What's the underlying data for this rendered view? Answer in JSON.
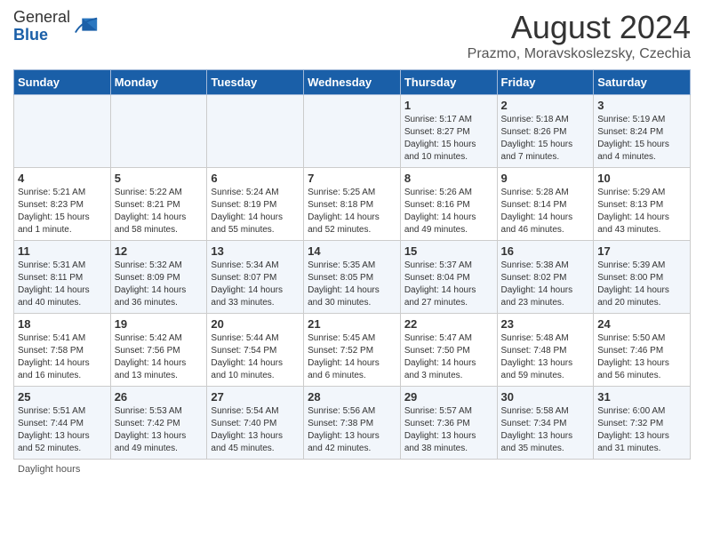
{
  "header": {
    "logo_general": "General",
    "logo_blue": "Blue",
    "main_title": "August 2024",
    "subtitle": "Prazmo, Moravskoslezsky, Czechia"
  },
  "columns": [
    "Sunday",
    "Monday",
    "Tuesday",
    "Wednesday",
    "Thursday",
    "Friday",
    "Saturday"
  ],
  "weeks": [
    {
      "days": [
        {
          "num": "",
          "info": ""
        },
        {
          "num": "",
          "info": ""
        },
        {
          "num": "",
          "info": ""
        },
        {
          "num": "",
          "info": ""
        },
        {
          "num": "1",
          "info": "Sunrise: 5:17 AM\nSunset: 8:27 PM\nDaylight: 15 hours\nand 10 minutes."
        },
        {
          "num": "2",
          "info": "Sunrise: 5:18 AM\nSunset: 8:26 PM\nDaylight: 15 hours\nand 7 minutes."
        },
        {
          "num": "3",
          "info": "Sunrise: 5:19 AM\nSunset: 8:24 PM\nDaylight: 15 hours\nand 4 minutes."
        }
      ]
    },
    {
      "days": [
        {
          "num": "4",
          "info": "Sunrise: 5:21 AM\nSunset: 8:23 PM\nDaylight: 15 hours\nand 1 minute."
        },
        {
          "num": "5",
          "info": "Sunrise: 5:22 AM\nSunset: 8:21 PM\nDaylight: 14 hours\nand 58 minutes."
        },
        {
          "num": "6",
          "info": "Sunrise: 5:24 AM\nSunset: 8:19 PM\nDaylight: 14 hours\nand 55 minutes."
        },
        {
          "num": "7",
          "info": "Sunrise: 5:25 AM\nSunset: 8:18 PM\nDaylight: 14 hours\nand 52 minutes."
        },
        {
          "num": "8",
          "info": "Sunrise: 5:26 AM\nSunset: 8:16 PM\nDaylight: 14 hours\nand 49 minutes."
        },
        {
          "num": "9",
          "info": "Sunrise: 5:28 AM\nSunset: 8:14 PM\nDaylight: 14 hours\nand 46 minutes."
        },
        {
          "num": "10",
          "info": "Sunrise: 5:29 AM\nSunset: 8:13 PM\nDaylight: 14 hours\nand 43 minutes."
        }
      ]
    },
    {
      "days": [
        {
          "num": "11",
          "info": "Sunrise: 5:31 AM\nSunset: 8:11 PM\nDaylight: 14 hours\nand 40 minutes."
        },
        {
          "num": "12",
          "info": "Sunrise: 5:32 AM\nSunset: 8:09 PM\nDaylight: 14 hours\nand 36 minutes."
        },
        {
          "num": "13",
          "info": "Sunrise: 5:34 AM\nSunset: 8:07 PM\nDaylight: 14 hours\nand 33 minutes."
        },
        {
          "num": "14",
          "info": "Sunrise: 5:35 AM\nSunset: 8:05 PM\nDaylight: 14 hours\nand 30 minutes."
        },
        {
          "num": "15",
          "info": "Sunrise: 5:37 AM\nSunset: 8:04 PM\nDaylight: 14 hours\nand 27 minutes."
        },
        {
          "num": "16",
          "info": "Sunrise: 5:38 AM\nSunset: 8:02 PM\nDaylight: 14 hours\nand 23 minutes."
        },
        {
          "num": "17",
          "info": "Sunrise: 5:39 AM\nSunset: 8:00 PM\nDaylight: 14 hours\nand 20 minutes."
        }
      ]
    },
    {
      "days": [
        {
          "num": "18",
          "info": "Sunrise: 5:41 AM\nSunset: 7:58 PM\nDaylight: 14 hours\nand 16 minutes."
        },
        {
          "num": "19",
          "info": "Sunrise: 5:42 AM\nSunset: 7:56 PM\nDaylight: 14 hours\nand 13 minutes."
        },
        {
          "num": "20",
          "info": "Sunrise: 5:44 AM\nSunset: 7:54 PM\nDaylight: 14 hours\nand 10 minutes."
        },
        {
          "num": "21",
          "info": "Sunrise: 5:45 AM\nSunset: 7:52 PM\nDaylight: 14 hours\nand 6 minutes."
        },
        {
          "num": "22",
          "info": "Sunrise: 5:47 AM\nSunset: 7:50 PM\nDaylight: 14 hours\nand 3 minutes."
        },
        {
          "num": "23",
          "info": "Sunrise: 5:48 AM\nSunset: 7:48 PM\nDaylight: 13 hours\nand 59 minutes."
        },
        {
          "num": "24",
          "info": "Sunrise: 5:50 AM\nSunset: 7:46 PM\nDaylight: 13 hours\nand 56 minutes."
        }
      ]
    },
    {
      "days": [
        {
          "num": "25",
          "info": "Sunrise: 5:51 AM\nSunset: 7:44 PM\nDaylight: 13 hours\nand 52 minutes."
        },
        {
          "num": "26",
          "info": "Sunrise: 5:53 AM\nSunset: 7:42 PM\nDaylight: 13 hours\nand 49 minutes."
        },
        {
          "num": "27",
          "info": "Sunrise: 5:54 AM\nSunset: 7:40 PM\nDaylight: 13 hours\nand 45 minutes."
        },
        {
          "num": "28",
          "info": "Sunrise: 5:56 AM\nSunset: 7:38 PM\nDaylight: 13 hours\nand 42 minutes."
        },
        {
          "num": "29",
          "info": "Sunrise: 5:57 AM\nSunset: 7:36 PM\nDaylight: 13 hours\nand 38 minutes."
        },
        {
          "num": "30",
          "info": "Sunrise: 5:58 AM\nSunset: 7:34 PM\nDaylight: 13 hours\nand 35 minutes."
        },
        {
          "num": "31",
          "info": "Sunrise: 6:00 AM\nSunset: 7:32 PM\nDaylight: 13 hours\nand 31 minutes."
        }
      ]
    }
  ],
  "footer": "Daylight hours"
}
